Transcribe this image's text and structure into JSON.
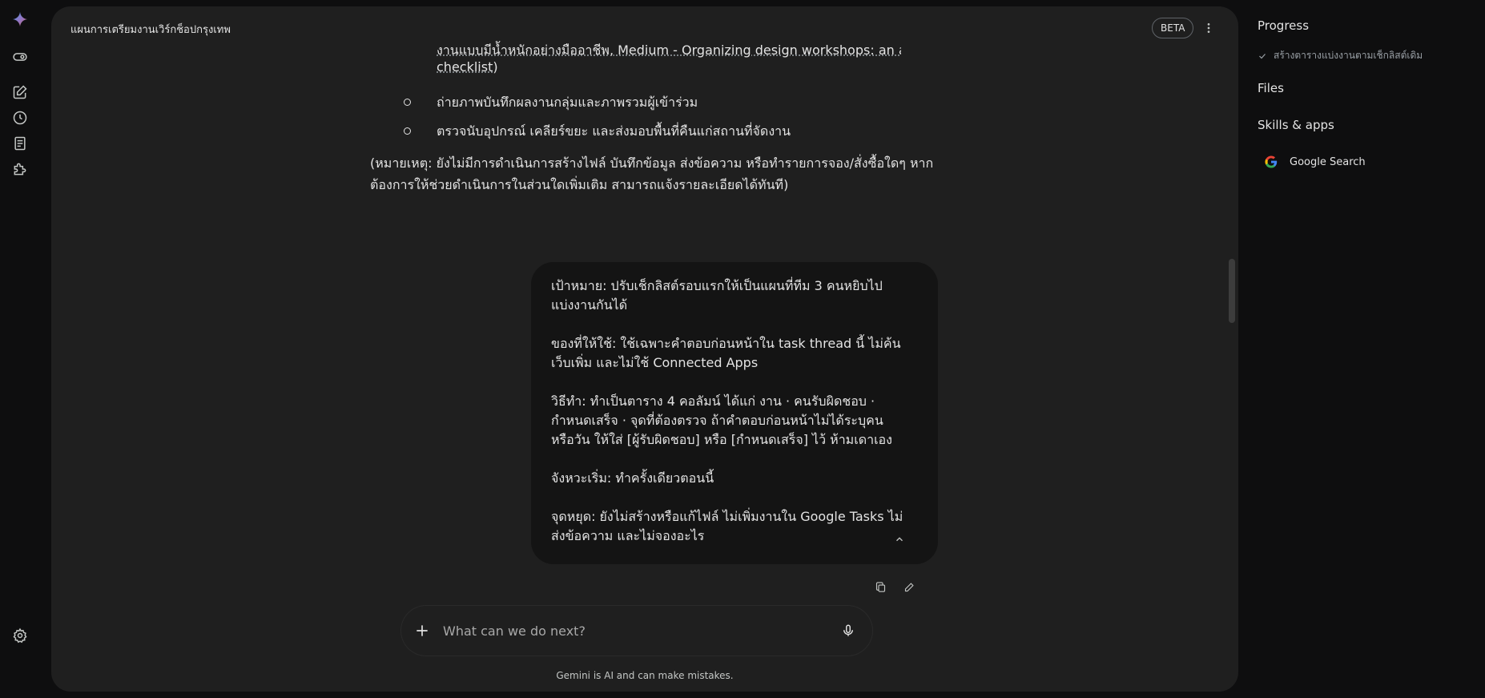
{
  "header": {
    "title": "แผนการเตรียมงานเวิร์กช็อปกรุงเทพ",
    "beta_label": "BETA"
  },
  "answer": {
    "cut_line_1": "งานแบบมีน้ำหนักอย่างมืออาชีพ, Medium - Organizing design workshops: an all-in-one",
    "cut_line_2_link": "checklist",
    "cut_line_2_tail": ")",
    "bullets": [
      "ถ่ายภาพบันทึกผลงานกลุ่มและภาพรวมผู้เข้าร่วม",
      "ตรวจนับอุปกรณ์ เคลียร์ขยะ และส่งมอบพื้นที่คืนแก่สถานที่จัดงาน"
    ],
    "note_line_1": "(หมายเหตุ: ยังไม่มีการดำเนินการสร้างไฟล์ บันทึกข้อมูล ส่งข้อความ หรือทำรายการจอง/สั่งซื้อใดๆ หาก",
    "note_line_2": "ต้องการให้ช่วยดำเนินการในส่วนใดเพิ่มเติม สามารถแจ้งรายละเอียดได้ทันที)"
  },
  "user_message": {
    "paragraphs": [
      "เป้าหมาย: ปรับเช็กลิสต์รอบแรกให้เป็นแผนที่ทีม 3 คนหยิบไปแบ่งงานกันได้",
      "ของที่ให้ใช้: ใช้เฉพาะคำตอบก่อนหน้าใน task thread นี้ ไม่ค้นเว็บเพิ่ม และไม่ใช้ Connected Apps",
      "วิธีทำ: ทำเป็นตาราง 4 คอลัมน์ ได้แก่ งาน · คนรับผิดชอบ · กำหนดเสร็จ · จุดที่ต้องตรวจ ถ้าคำตอบก่อนหน้าไม่ได้ระบุคนหรือวัน ให้ใส่ [ผู้รับผิดชอบ] หรือ [กำหนดเสร็จ] ไว้ ห้ามเดาเอง",
      "จังหวะเริ่ม: ทำครั้งเดียวตอนนี้",
      "จุดหยุด: ยังไม่สร้างหรือแก้ไฟล์ ไม่เพิ่มงานใน Google Tasks ไม่ส่งข้อความ และไม่จองอะไร"
    ]
  },
  "composer": {
    "placeholder": "What can we do next?"
  },
  "footer": {
    "disclaimer": "Gemini is AI and can make mistakes."
  },
  "side_panel": {
    "progress_title": "Progress",
    "progress_items": [
      "สร้างตารางแบ่งงานตามเช็กลิสต์เดิม"
    ],
    "files_title": "Files",
    "skills_title": "Skills & apps",
    "skills": [
      "Google Search"
    ]
  },
  "colors": {
    "background": "#0e0e0f",
    "panel": "#1f1f1f",
    "bubble": "#141414",
    "text": "#e3e3e3"
  }
}
